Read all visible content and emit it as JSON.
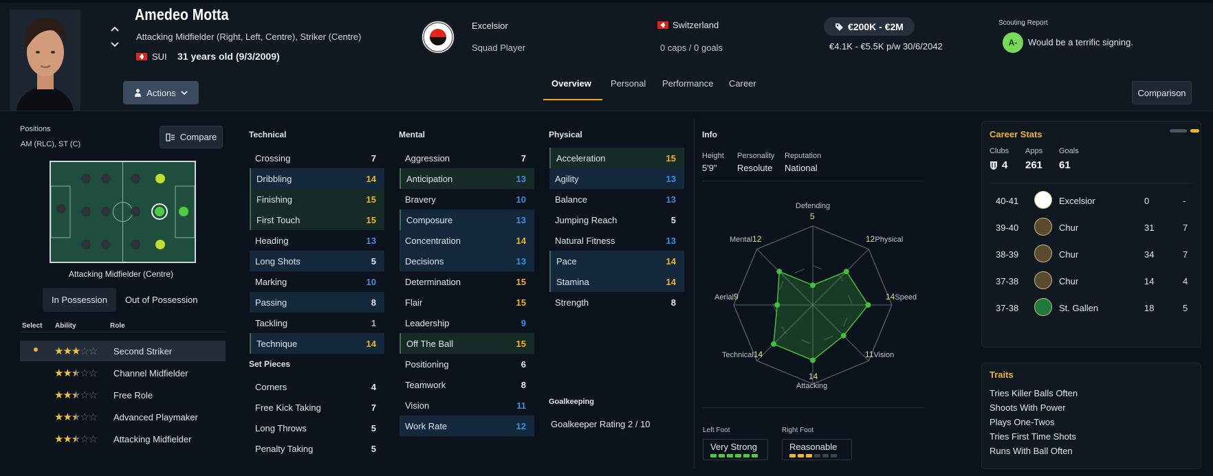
{
  "player": {
    "name": "Amedeo Motta",
    "positions_full": "Attacking Midfielder (Right, Left, Centre), Striker (Centre)",
    "nation": "SUI",
    "age": "31 years old (9/3/2009)"
  },
  "header": {
    "actions_label": "Actions",
    "club": "Excelsior",
    "squad_status": "Squad Player",
    "country": "Switzerland",
    "caps": "0 caps / 0 goals",
    "value": "€200K - €2M",
    "wage": "€4.1K - €5.5K p/w 30/6/2042",
    "scout_title": "Scouting Report",
    "scout_grade": "A-",
    "scout_text": "Would be a terrific signing.",
    "comparison_label": "Comparison"
  },
  "tabs": [
    "Overview",
    "Personal",
    "Performance",
    "Career"
  ],
  "left": {
    "positions_label": "Positions",
    "positions_value": "AM (RLC), ST (C)",
    "compare_label": "Compare",
    "pitch_caption": "Attacking Midfielder (Centre)",
    "seg": [
      "In Possession",
      "Out of Possession"
    ],
    "role_headers": [
      "Select",
      "Ability",
      "Role"
    ],
    "roles": [
      {
        "name": "Second Striker",
        "stars": 3
      },
      {
        "name": "Channel Midfielder",
        "stars": 2.5
      },
      {
        "name": "Free Role",
        "stars": 2.5
      },
      {
        "name": "Advanced Playmaker",
        "stars": 2.5
      },
      {
        "name": "Attacking Midfielder",
        "stars": 2.5
      }
    ]
  },
  "attributes": {
    "technical_title": "Technical",
    "technical": [
      {
        "name": "Crossing",
        "value": 7
      },
      {
        "name": "Dribbling",
        "value": 14
      },
      {
        "name": "Finishing",
        "value": 15
      },
      {
        "name": "First Touch",
        "value": 15
      },
      {
        "name": "Heading",
        "value": 13
      },
      {
        "name": "Long Shots",
        "value": 5
      },
      {
        "name": "Marking",
        "value": 10
      },
      {
        "name": "Passing",
        "value": 8
      },
      {
        "name": "Tackling",
        "value": 1
      },
      {
        "name": "Technique",
        "value": 14
      }
    ],
    "setpieces_title": "Set Pieces",
    "setpieces": [
      {
        "name": "Corners",
        "value": 4
      },
      {
        "name": "Free Kick Taking",
        "value": 7
      },
      {
        "name": "Long Throws",
        "value": 5
      },
      {
        "name": "Penalty Taking",
        "value": 5
      }
    ],
    "mental_title": "Mental",
    "mental": [
      {
        "name": "Aggression",
        "value": 7
      },
      {
        "name": "Anticipation",
        "value": 13
      },
      {
        "name": "Bravery",
        "value": 10
      },
      {
        "name": "Composure",
        "value": 13
      },
      {
        "name": "Concentration",
        "value": 14
      },
      {
        "name": "Decisions",
        "value": 13
      },
      {
        "name": "Determination",
        "value": 15
      },
      {
        "name": "Flair",
        "value": 15
      },
      {
        "name": "Leadership",
        "value": 9
      },
      {
        "name": "Off The Ball",
        "value": 15
      },
      {
        "name": "Positioning",
        "value": 6
      },
      {
        "name": "Teamwork",
        "value": 8
      },
      {
        "name": "Vision",
        "value": 11
      },
      {
        "name": "Work Rate",
        "value": 12
      }
    ],
    "physical_title": "Physical",
    "physical": [
      {
        "name": "Acceleration",
        "value": 15
      },
      {
        "name": "Agility",
        "value": 13
      },
      {
        "name": "Balance",
        "value": 13
      },
      {
        "name": "Jumping Reach",
        "value": 5
      },
      {
        "name": "Natural Fitness",
        "value": 13
      },
      {
        "name": "Pace",
        "value": 14
      },
      {
        "name": "Stamina",
        "value": 14
      },
      {
        "name": "Strength",
        "value": 8
      }
    ],
    "gk_title": "Goalkeeping",
    "gk_rating": "Goalkeeper Rating  2 / 10"
  },
  "info": {
    "title": "Info",
    "height_label": "Height",
    "height": "5'9\"",
    "personality_label": "Personality",
    "personality": "Resolute",
    "reputation_label": "Reputation",
    "reputation": "National",
    "radar": [
      {
        "label": "Defending",
        "value": 5
      },
      {
        "label": "Physical",
        "value": 12
      },
      {
        "label": "Speed",
        "value": 14
      },
      {
        "label": "Vision",
        "value": 11
      },
      {
        "label": "Attacking",
        "value": 14
      },
      {
        "label": "Technical",
        "value": 14
      },
      {
        "label": "Aerial",
        "value": 9
      },
      {
        "label": "Mental",
        "value": 12
      }
    ],
    "left_foot_label": "Left Foot",
    "left_foot": "Very Strong",
    "left_foot_level": 6,
    "right_foot_label": "Right Foot",
    "right_foot": "Reasonable",
    "right_foot_level": 3
  },
  "career": {
    "title": "Career Stats",
    "clubs_label": "Clubs",
    "clubs": "4",
    "apps_label": "Apps",
    "apps": "261",
    "goals_label": "Goals",
    "goals": "61",
    "rows": [
      {
        "season": "40-41",
        "club": "Excelsior",
        "apps": "0",
        "goals": "-"
      },
      {
        "season": "39-40",
        "club": "Chur",
        "apps": "31",
        "goals": "7"
      },
      {
        "season": "38-39",
        "club": "Chur",
        "apps": "34",
        "goals": "7"
      },
      {
        "season": "37-38",
        "club": "Chur",
        "apps": "14",
        "goals": "4"
      },
      {
        "season": "37-38",
        "club": "St. Gallen",
        "apps": "18",
        "goals": "5"
      }
    ]
  },
  "traits": {
    "title": "Traits",
    "items": [
      "Tries Killer Balls Often",
      "Shoots With Power",
      "Plays One-Twos",
      "Tries First Time Shots",
      "Runs With Ball Often"
    ]
  },
  "colors": {
    "accent": "#f0b429",
    "blue_value": "#3f8fe5",
    "green": "#4ccd3f",
    "background": "#0c121b"
  }
}
